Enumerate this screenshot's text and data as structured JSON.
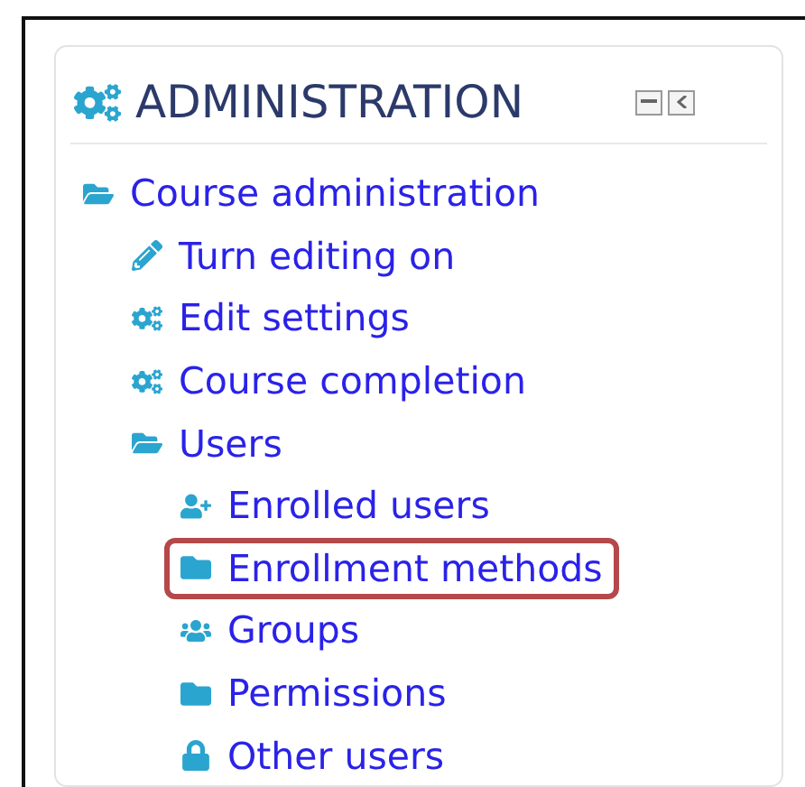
{
  "block": {
    "title": "ADMINISTRATION",
    "items": [
      {
        "label": "Course administration",
        "kind": "folder-open",
        "highlighted": false,
        "children": [
          {
            "label": "Turn editing on",
            "kind": "pencil",
            "highlighted": false
          },
          {
            "label": "Edit settings",
            "kind": "gears",
            "highlighted": false
          },
          {
            "label": "Course completion",
            "kind": "gears",
            "highlighted": false
          },
          {
            "label": "Users",
            "kind": "folder-open",
            "highlighted": false,
            "children": [
              {
                "label": "Enrolled users",
                "kind": "user-plus",
                "highlighted": false
              },
              {
                "label": "Enrollment methods",
                "kind": "folder",
                "highlighted": true
              },
              {
                "label": "Groups",
                "kind": "users",
                "highlighted": false
              },
              {
                "label": "Permissions",
                "kind": "folder",
                "highlighted": false
              },
              {
                "label": "Other users",
                "kind": "lock",
                "highlighted": false
              }
            ]
          }
        ]
      }
    ]
  }
}
